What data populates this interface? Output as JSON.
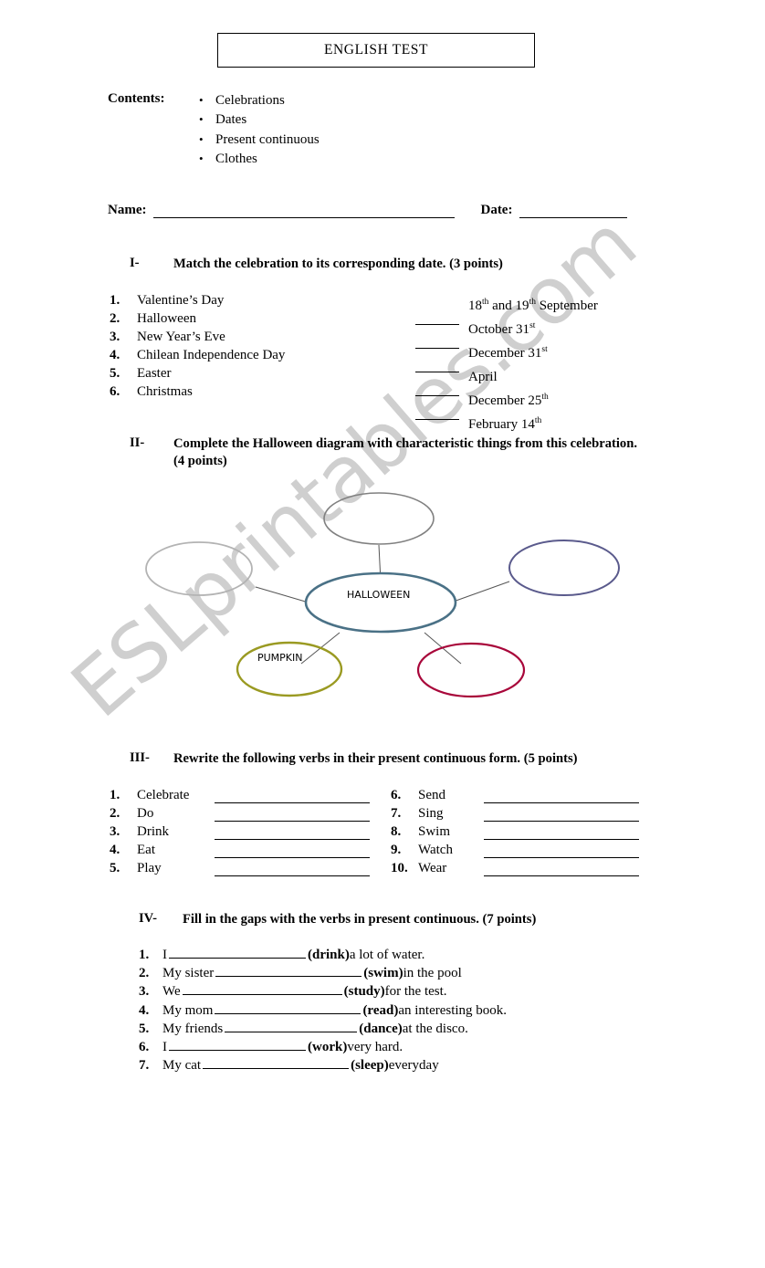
{
  "document": {
    "title": "ENGLISH TEST",
    "watermark": "ESLprintables.com"
  },
  "contents": {
    "label": "Contents:",
    "items": [
      "Celebrations",
      "Dates",
      "Present continuous",
      "Clothes"
    ]
  },
  "student_fields": {
    "name_label": "Name:",
    "date_label": "Date:",
    "name_value": "",
    "date_value": ""
  },
  "sections": {
    "one": {
      "numeral": "I-",
      "instruction": "Match the celebration to its corresponding date. (3 points)",
      "celebrations": [
        {
          "num": "1.",
          "text": "Valentine’s Day"
        },
        {
          "num": "2.",
          "text": "Halloween"
        },
        {
          "num": "3.",
          "text": "New Year’s Eve"
        },
        {
          "num": "4.",
          "text": "Chilean Independence Day"
        },
        {
          "num": "5.",
          "text": "Easter"
        },
        {
          "num": "6.",
          "text": "Christmas"
        }
      ],
      "dates": [
        {
          "main": "18",
          "sup": "th",
          "mid": " and 19",
          "sup2": "th",
          "tail": " September",
          "blank": false
        },
        {
          "main": "October 31",
          "sup": "st",
          "mid": "",
          "sup2": "",
          "tail": "",
          "blank": true
        },
        {
          "main": "December 31",
          "sup": "st",
          "mid": "",
          "sup2": "",
          "tail": "",
          "blank": true
        },
        {
          "main": "April",
          "sup": "",
          "mid": "",
          "sup2": "",
          "tail": "",
          "blank": true
        },
        {
          "main": "December 25",
          "sup": "th",
          "mid": "",
          "sup2": "",
          "tail": "",
          "blank": true
        },
        {
          "main": "February 14",
          "sup": "th",
          "mid": "",
          "sup2": "",
          "tail": "",
          "blank": true
        }
      ]
    },
    "two": {
      "numeral": "II-",
      "instruction": "Complete the Halloween diagram with characteristic things from this celebration. (4 points)",
      "diagram": {
        "center": {
          "label": "HALLOWEEN",
          "color": "#4a7186"
        },
        "nodes": [
          {
            "label": "",
            "color": "#808080",
            "position": "top"
          },
          {
            "label": "",
            "color": "#b3b3b3",
            "position": "left"
          },
          {
            "label": "",
            "color": "#5a5a8c",
            "position": "right"
          },
          {
            "label": "PUMPKIN",
            "color": "#9a9a22",
            "position": "bottom-left"
          },
          {
            "label": "",
            "color": "#a8063a",
            "position": "bottom-right"
          }
        ]
      }
    },
    "three": {
      "numeral": "III-",
      "instruction": "Rewrite the following verbs in their present continuous form. (5 points)",
      "verbs_left": [
        {
          "num": "1.",
          "verb": "Celebrate"
        },
        {
          "num": "2.",
          "verb": "Do"
        },
        {
          "num": "3.",
          "verb": "Drink"
        },
        {
          "num": "4.",
          "verb": "Eat"
        },
        {
          "num": "5.",
          "verb": "Play"
        }
      ],
      "verbs_right": [
        {
          "num": "6.",
          "verb": "Send"
        },
        {
          "num": "7.",
          "verb": "Sing"
        },
        {
          "num": "8.",
          "verb": "Swim"
        },
        {
          "num": "9.",
          "verb": "Watch"
        },
        {
          "num": "10.",
          "verb": "Wear"
        }
      ]
    },
    "four": {
      "numeral": "IV-",
      "instruction": "Fill in the gaps with the verbs in present continuous. (7 points)",
      "sentences": [
        {
          "num": "1.",
          "pre": "I",
          "verb": "(drink)",
          "post": "a lot of water.",
          "gap_width": 150
        },
        {
          "num": "2.",
          "pre": "My sister",
          "verb": "(swim)",
          "post": "in the pool",
          "gap_width": 160
        },
        {
          "num": "3.",
          "pre": "We",
          "verb": "(study)",
          "post": "for the test.",
          "gap_width": 175
        },
        {
          "num": "4.",
          "pre": "My mom",
          "verb": "(read)",
          "post": "an interesting book.",
          "gap_width": 160
        },
        {
          "num": "5.",
          "pre": "My friends",
          "verb": "(dance)",
          "post": "at the disco.",
          "gap_width": 145
        },
        {
          "num": "6.",
          "pre": "I",
          "verb": "(work)",
          "post": "very hard.",
          "gap_width": 150
        },
        {
          "num": "7.",
          "pre": "My cat",
          "verb": "(sleep)",
          "post": "everyday",
          "gap_width": 160
        }
      ]
    }
  }
}
